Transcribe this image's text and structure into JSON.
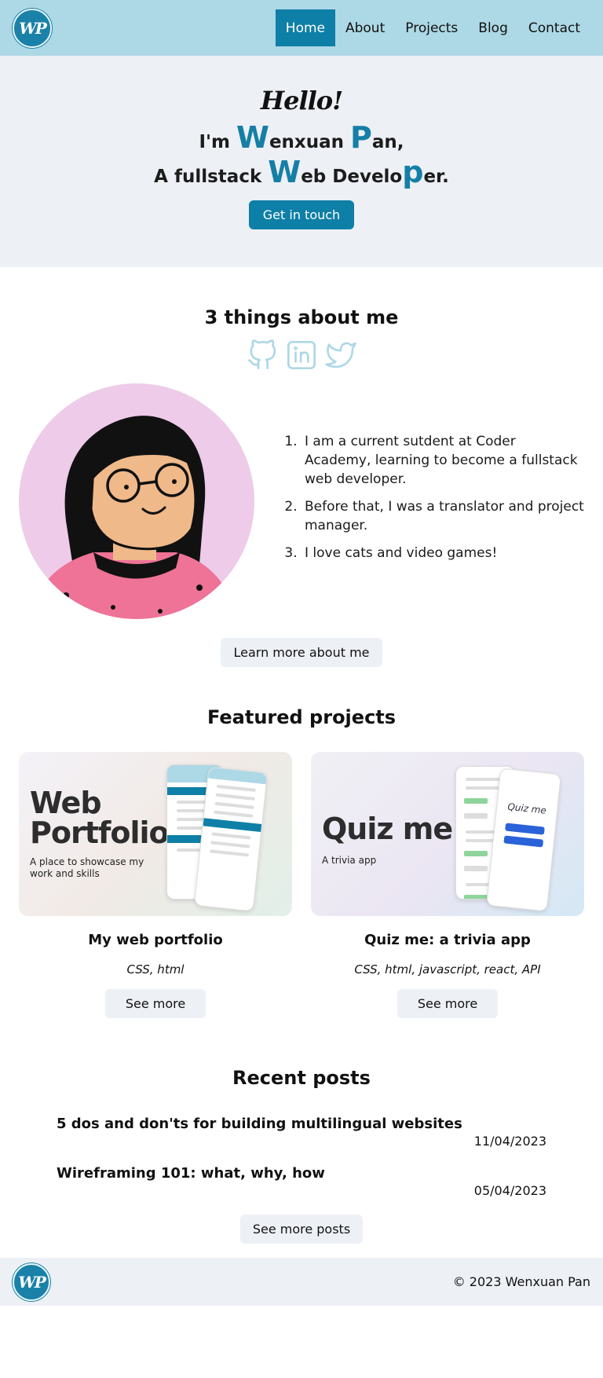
{
  "nav": {
    "logo_text": "WP",
    "links": [
      {
        "label": "Home",
        "active": true
      },
      {
        "label": "About",
        "active": false
      },
      {
        "label": "Projects",
        "active": false
      },
      {
        "label": "Blog",
        "active": false
      },
      {
        "label": "Contact",
        "active": false
      }
    ]
  },
  "hero": {
    "hello": "Hello!",
    "line1": {
      "pre": "I'm ",
      "w": "W",
      "mid": "enxuan ",
      "p": "P",
      "post": "an,"
    },
    "line2": {
      "pre": "A fullstack ",
      "w": "W",
      "mid": "eb Develo",
      "p": "p",
      "post": "er."
    },
    "cta": "Get in touch"
  },
  "about": {
    "title": "3 things about me",
    "social_icons": [
      "github-icon",
      "linkedin-icon",
      "twitter-icon"
    ],
    "facts": [
      "I am a current sutdent at Coder Academy, learning to become a fullstack web developer.",
      "Before that, I was a translator and project manager.",
      "I love cats and video games!"
    ],
    "button": "Learn more about me"
  },
  "projects": {
    "title": "Featured projects",
    "items": [
      {
        "image_title_1": "Web",
        "image_title_2": "Portfolio",
        "image_subtitle": "A place to showcase my work and skills",
        "name": "My web portfolio",
        "tags": "CSS, html",
        "button": "See more"
      },
      {
        "image_title_1": "Quiz me",
        "image_title_2": "",
        "image_subtitle": "A trivia app",
        "phone_title": "Quiz me",
        "name": "Quiz me: a trivia app",
        "tags": "CSS, html, javascript, react, API",
        "button": "See more"
      }
    ]
  },
  "posts": {
    "title": "Recent posts",
    "items": [
      {
        "title": "5 dos and don'ts for building multilingual websites",
        "date": "11/04/2023"
      },
      {
        "title": "Wireframing 101: what, why, how",
        "date": "05/04/2023"
      }
    ],
    "button": "See more posts"
  },
  "footer": {
    "copyright": "© 2023 Wenxuan Pan"
  },
  "colors": {
    "nav_bg": "#add8e6",
    "accent": "#0e7fa6",
    "light_bg": "#edf0f5"
  }
}
